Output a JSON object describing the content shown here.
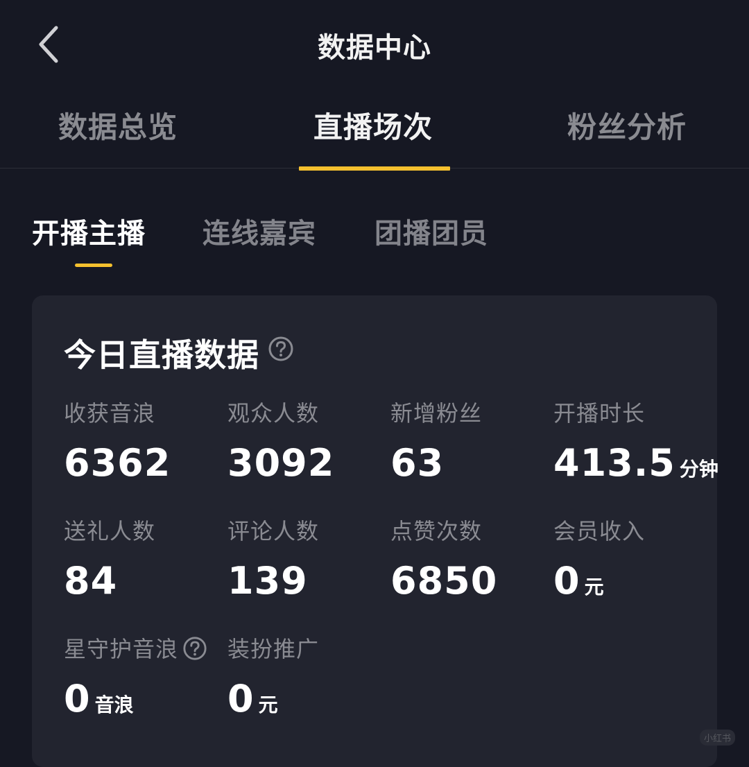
{
  "header": {
    "title": "数据中心"
  },
  "main_tabs": [
    {
      "label": "数据总览",
      "active": false
    },
    {
      "label": "直播场次",
      "active": true
    },
    {
      "label": "粉丝分析",
      "active": false
    }
  ],
  "sub_tabs": [
    {
      "label": "开播主播",
      "active": true
    },
    {
      "label": "连线嘉宾",
      "active": false
    },
    {
      "label": "团播团员",
      "active": false
    }
  ],
  "card": {
    "title": "今日直播数据",
    "metrics": [
      {
        "label": "收获音浪",
        "value": "6362",
        "unit": ""
      },
      {
        "label": "观众人数",
        "value": "3092",
        "unit": ""
      },
      {
        "label": "新增粉丝",
        "value": "63",
        "unit": ""
      },
      {
        "label": "开播时长",
        "value": "413.5",
        "unit": "分钟"
      },
      {
        "label": "送礼人数",
        "value": "84",
        "unit": ""
      },
      {
        "label": "评论人数",
        "value": "139",
        "unit": ""
      },
      {
        "label": "点赞次数",
        "value": "6850",
        "unit": ""
      },
      {
        "label": "会员收入",
        "value": "0",
        "unit": "元"
      },
      {
        "label": "星守护音浪",
        "value": "0",
        "unit": "音浪"
      },
      {
        "label": "装扮推广",
        "value": "0",
        "unit": "元"
      }
    ]
  },
  "watermark": "小红书",
  "colors": {
    "background": "#161823",
    "card": "#22242f",
    "accent": "#f5c02e",
    "muted_text": "#8a8b92"
  }
}
